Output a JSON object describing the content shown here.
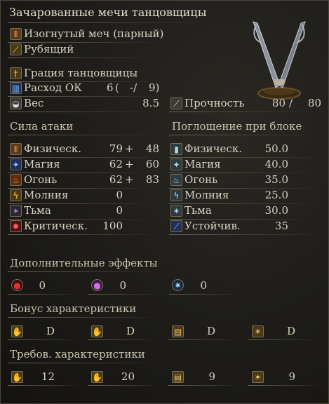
{
  "title": "Зачарованные мечи танцовщицы",
  "weapon_type": "Изогнутый меч (парный)",
  "attack_type": "Рубящий",
  "skill": "Грация танцовщицы",
  "fp_cost": {
    "label": "Расход ОК",
    "a": "6",
    "b": "(",
    "c": "-/",
    "d": "9)"
  },
  "weight": {
    "label": "Вес",
    "value": "8.5"
  },
  "durability": {
    "label": "Прочность",
    "current": "80",
    "sep": "/",
    "max": "80"
  },
  "attack": {
    "header": "Сила атаки",
    "rows": [
      {
        "label": "Физическ.",
        "base": "79",
        "plus": "+",
        "bonus": "48"
      },
      {
        "label": "Магия",
        "base": "62",
        "plus": "+",
        "bonus": "60"
      },
      {
        "label": "Огонь",
        "base": "62",
        "plus": "+",
        "bonus": "83"
      },
      {
        "label": "Молния",
        "base": "0",
        "plus": "",
        "bonus": ""
      },
      {
        "label": "Тьма",
        "base": "0",
        "plus": "",
        "bonus": ""
      },
      {
        "label": "Критическ.",
        "base": "100",
        "plus": "",
        "bonus": ""
      }
    ]
  },
  "guard": {
    "header": "Поглощение при блоке",
    "rows": [
      {
        "label": "Физическ.",
        "value": "50.0"
      },
      {
        "label": "Магия",
        "value": "40.0"
      },
      {
        "label": "Огонь",
        "value": "35.0"
      },
      {
        "label": "Молния",
        "value": "25.0"
      },
      {
        "label": "Тьма",
        "value": "30.0"
      },
      {
        "label": "Устойчив.",
        "value": "35"
      }
    ]
  },
  "effects": {
    "header": "Дополнительные эффекты",
    "values": [
      "0",
      "0",
      "0"
    ],
    "icons": [
      "bleed-icon",
      "poison-icon",
      "frost-icon"
    ]
  },
  "bonus": {
    "header": "Бонус характеристики",
    "values": [
      "D",
      "D",
      "D",
      "D"
    ],
    "icons": [
      "strength-icon",
      "dexterity-icon",
      "intelligence-icon",
      "faith-icon"
    ]
  },
  "requirements": {
    "header": "Требов. характеристики",
    "values": [
      "12",
      "20",
      "9",
      "9"
    ]
  }
}
